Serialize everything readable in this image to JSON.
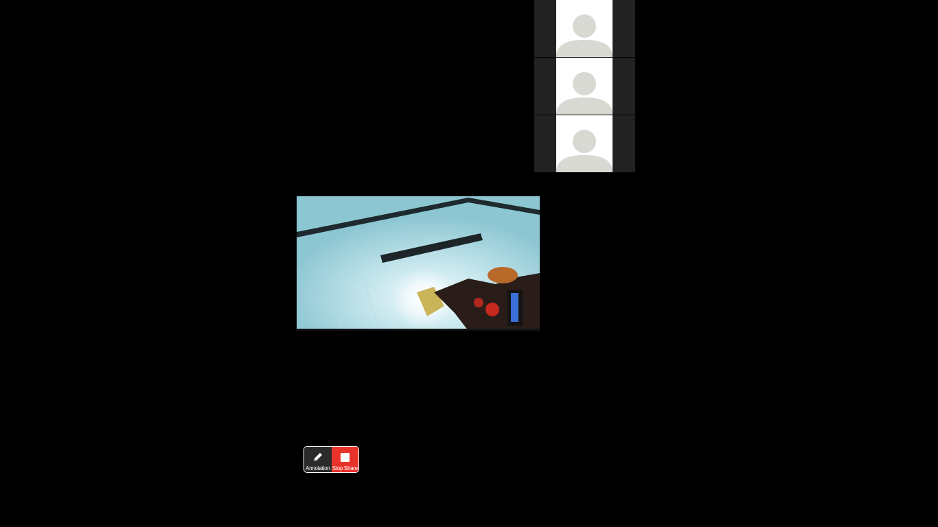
{
  "participants": [
    {
      "avatar_icon": "default-user-icon"
    },
    {
      "avatar_icon": "default-user-icon"
    },
    {
      "avatar_icon": "default-user-icon"
    }
  ],
  "share_controls": {
    "annotation_label": "Annotation",
    "annotation_icon": "pencil-icon",
    "stop_share_label": "Stop Share",
    "stop_share_icon": "stop-square-icon",
    "stop_color": "#e8332b"
  },
  "colors": {
    "background": "#000000",
    "thumb_background": "#222222",
    "avatar_silhouette": "#d9d9d4"
  }
}
